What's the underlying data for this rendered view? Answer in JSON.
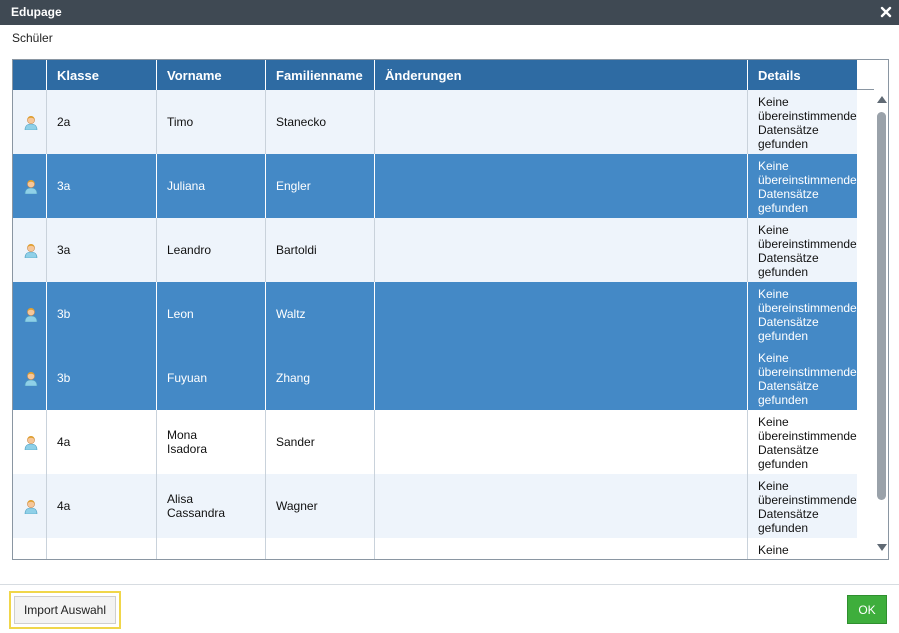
{
  "window": {
    "title": "Edupage"
  },
  "subtitle": "Schüler",
  "grid": {
    "columns": [
      "",
      "Klasse",
      "Vorname",
      "Familienname",
      "Änderungen",
      "Details"
    ],
    "rows": [
      {
        "klasse": "2a",
        "vorname": "Timo",
        "familienname": "Stanecko",
        "aenderungen": "",
        "details": "Keine\nübereinstimmende\nDatensätze\ngefunden",
        "selected": false
      },
      {
        "klasse": "3a",
        "vorname": "Juliana",
        "familienname": "Engler",
        "aenderungen": "",
        "details": "Keine\nübereinstimmende\nDatensätze\ngefunden",
        "selected": true
      },
      {
        "klasse": "3a",
        "vorname": "Leandro",
        "familienname": "Bartoldi",
        "aenderungen": "",
        "details": "Keine\nübereinstimmende\nDatensätze\ngefunden",
        "selected": false
      },
      {
        "klasse": "3b",
        "vorname": "Leon",
        "familienname": "Waltz",
        "aenderungen": "",
        "details": "Keine\nübereinstimmende\nDatensätze\ngefunden",
        "selected": true
      },
      {
        "klasse": "3b",
        "vorname": "Fuyuan",
        "familienname": "Zhang",
        "aenderungen": "",
        "details": "Keine\nübereinstimmende\nDatensätze\ngefunden",
        "selected": true
      },
      {
        "klasse": "4a",
        "vorname": "Mona\nIsadora",
        "familienname": "Sander",
        "aenderungen": "",
        "details": "Keine\nübereinstimmende\nDatensätze\ngefunden",
        "selected": false
      },
      {
        "klasse": "4a",
        "vorname": "Alisa\nCassandra",
        "familienname": "Wagner",
        "aenderungen": "",
        "details": "Keine\nübereinstimmende\nDatensätze\ngefunden",
        "selected": false
      },
      {
        "klasse": "",
        "vorname": "",
        "familienname": "",
        "aenderungen": "",
        "details": "Keine\nübereinstimmende",
        "selected": false
      }
    ]
  },
  "footer": {
    "import_label": "Import Auswahl",
    "ok_label": "OK"
  },
  "icons": {
    "close": "close-icon",
    "row": "user-icon"
  },
  "colors": {
    "titlebar": "#3f4953",
    "header": "#2e6ba3",
    "selected_row": "#4489c6",
    "ok_button": "#3eae3c",
    "focus_outline": "#f0d64a"
  }
}
